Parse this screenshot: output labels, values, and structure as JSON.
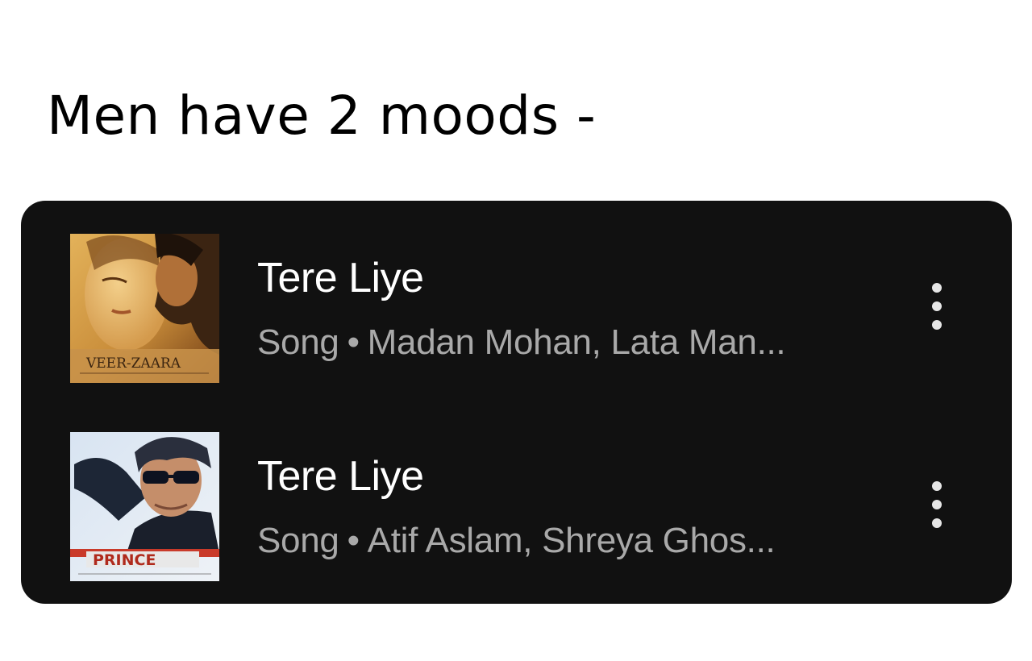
{
  "meme": {
    "caption": "Men have 2 moods -"
  },
  "results": [
    {
      "title": "Tere Liye",
      "type": "Song",
      "separator": "•",
      "artists": "Madan Mohan, Lata Man...",
      "art_text": "VEER-ZAARA"
    },
    {
      "title": "Tere Liye",
      "type": "Song",
      "separator": "•",
      "artists": "Atif Aslam, Shreya Ghos...",
      "art_text": "PRINCE"
    }
  ],
  "icons": {
    "more": "more-vertical-icon"
  },
  "colors": {
    "panel_bg": "#111111",
    "title": "#ffffff",
    "subtitle": "#a9a9a9",
    "page_bg": "#ffffff"
  }
}
